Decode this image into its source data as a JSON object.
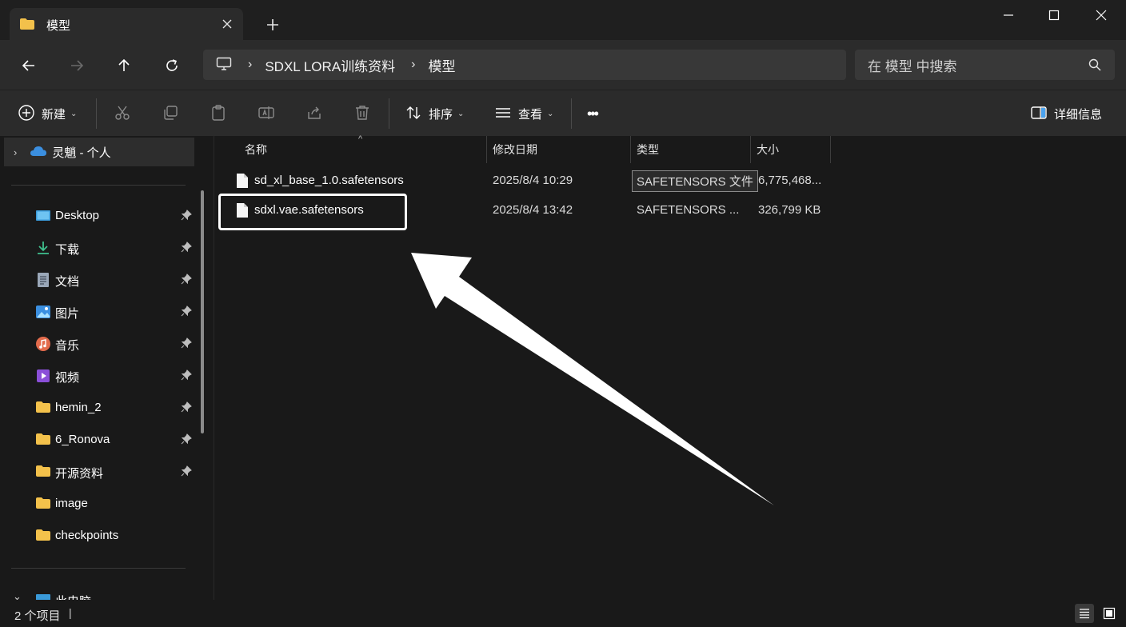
{
  "window": {
    "tab_title": "模型"
  },
  "nav": {
    "breadcrumb": [
      "SDXL LORA训练资料",
      "模型"
    ],
    "search_placeholder": "在 模型 中搜索"
  },
  "toolbar": {
    "new_label": "新建",
    "sort_label": "排序",
    "view_label": "查看",
    "more_label": "•••",
    "details_label": "详细信息"
  },
  "sidebar": {
    "onedrive_label": "灵魈 - 个人",
    "items": [
      {
        "label": "Desktop",
        "icon": "desktop-icon",
        "pinned": true
      },
      {
        "label": "下载",
        "icon": "download-icon",
        "pinned": true
      },
      {
        "label": "文档",
        "icon": "document-icon",
        "pinned": true
      },
      {
        "label": "图片",
        "icon": "pictures-icon",
        "pinned": true
      },
      {
        "label": "音乐",
        "icon": "music-icon",
        "pinned": true
      },
      {
        "label": "视频",
        "icon": "video-icon",
        "pinned": true
      },
      {
        "label": "hemin_2",
        "icon": "folder-icon",
        "pinned": true
      },
      {
        "label": "6_Ronova",
        "icon": "folder-icon",
        "pinned": true
      },
      {
        "label": "开源资料",
        "icon": "folder-icon",
        "pinned": true
      },
      {
        "label": "image",
        "icon": "folder-icon",
        "pinned": false
      },
      {
        "label": "checkpoints",
        "icon": "folder-icon",
        "pinned": false
      }
    ],
    "this_pc_label": "此电脑"
  },
  "columns": {
    "name": "名称",
    "date": "修改日期",
    "type": "类型",
    "size": "大小"
  },
  "files": [
    {
      "name": "sd_xl_base_1.0.safetensors",
      "date": "2025/8/4 10:29",
      "type": "SAFETENSORS 文件",
      "size": "6,775,468..."
    },
    {
      "name": "sdxl.vae.safetensors",
      "date": "2025/8/4 13:42",
      "type": "SAFETENSORS ...",
      "size": "326,799 KB"
    }
  ],
  "status": {
    "item_count": "2 个项目"
  },
  "colors": {
    "background": "#191919",
    "panel": "#2b2b2b",
    "folder": "#f3c14b",
    "highlight": "#ffffff"
  }
}
